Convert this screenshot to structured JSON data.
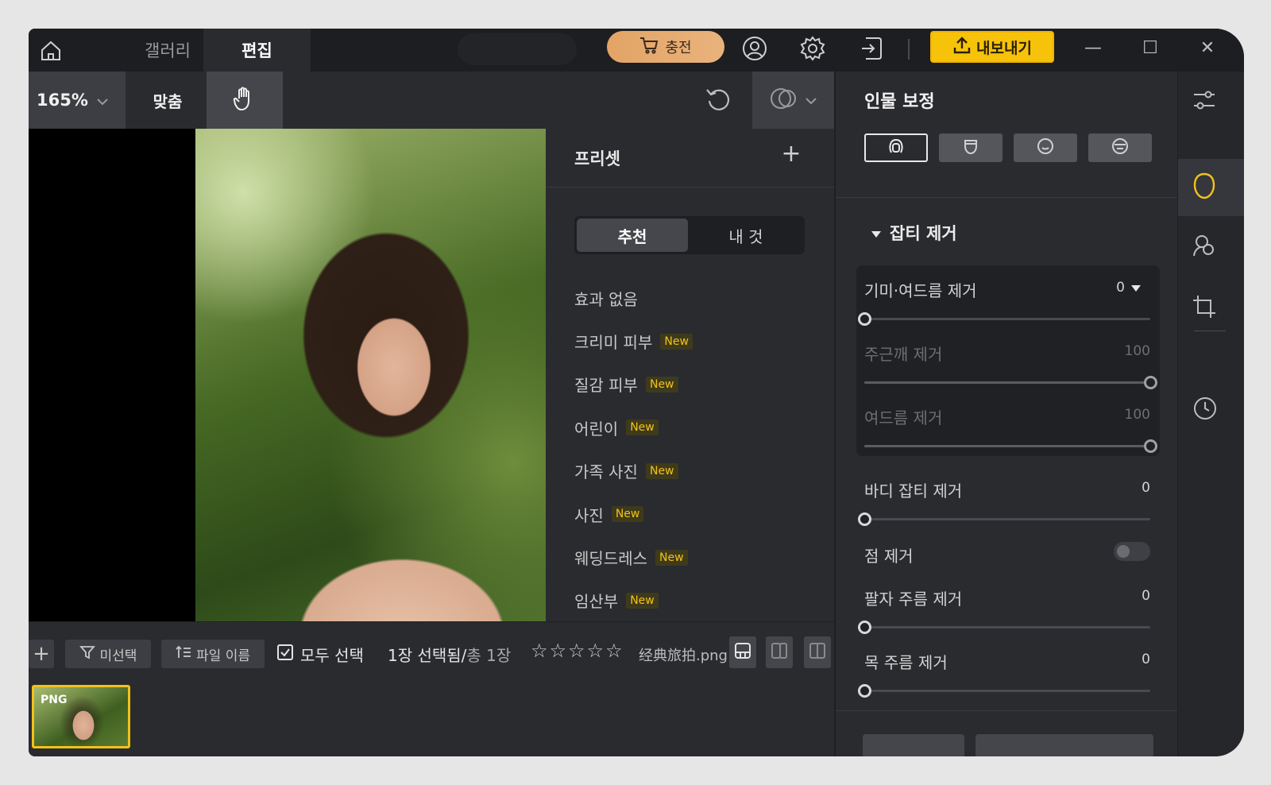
{
  "titlebar": {
    "tabs": {
      "gallery": "갤러리",
      "edit": "편집"
    },
    "charge_label": "충전",
    "export_label": "내보내기",
    "icons": [
      "home-icon",
      "cart-icon",
      "user-icon",
      "settings-icon",
      "login-icon",
      "upload-icon"
    ],
    "window_controls": {
      "minimize": "—",
      "maximize": "☐",
      "close": "✕"
    }
  },
  "toolbar": {
    "zoom_value": "165%",
    "fit_label": "맞춤"
  },
  "presets": {
    "title": "프리셋",
    "add": "+",
    "segments": {
      "recommended": "추천",
      "mine": "내 것"
    },
    "items": [
      {
        "label": "효과 없음",
        "badge": ""
      },
      {
        "label": "크리미 피부",
        "badge": "New"
      },
      {
        "label": "질감 피부",
        "badge": "New"
      },
      {
        "label": "어린이",
        "badge": "New"
      },
      {
        "label": "가족 사진",
        "badge": "New"
      },
      {
        "label": "사진",
        "badge": "New"
      },
      {
        "label": "웨딩드레스",
        "badge": "New"
      },
      {
        "label": "임산부",
        "badge": "New"
      }
    ]
  },
  "right_panel": {
    "title": "인물 보정",
    "section": "잡티 제거",
    "sliders": {
      "spots_acne": {
        "label": "기미·여드름 제거",
        "value": "0",
        "level": 0
      },
      "freckles": {
        "label": "주근깨 제거",
        "value": "100",
        "level": 1
      },
      "acne": {
        "label": "여드름 제거",
        "value": "100",
        "level": 1
      },
      "body": {
        "label": "바디 잡티 제거",
        "value": "0",
        "level": 0
      },
      "mole": {
        "label": "점 제거",
        "toggle": false
      },
      "nasolabial": {
        "label": "팔자 주름 제거",
        "value": "0",
        "level": 0
      },
      "neck": {
        "label": "목 주름 제거",
        "value": "0",
        "level": 0
      }
    }
  },
  "filebar": {
    "add": "+",
    "filter_label": "미선택",
    "sort_label": "파일 이름",
    "select_all": "모두 선택",
    "selected_prefix": "1장 선택됨/",
    "total": "총 1장",
    "stars": "☆☆☆☆☆",
    "filename": "经典旅拍.png",
    "thumb_format": "PNG"
  },
  "colors": {
    "accent": "#f7c20a",
    "charge": "#e3a465",
    "badge_text": "#f2c21a",
    "window_bg": "#2a2b2f"
  }
}
